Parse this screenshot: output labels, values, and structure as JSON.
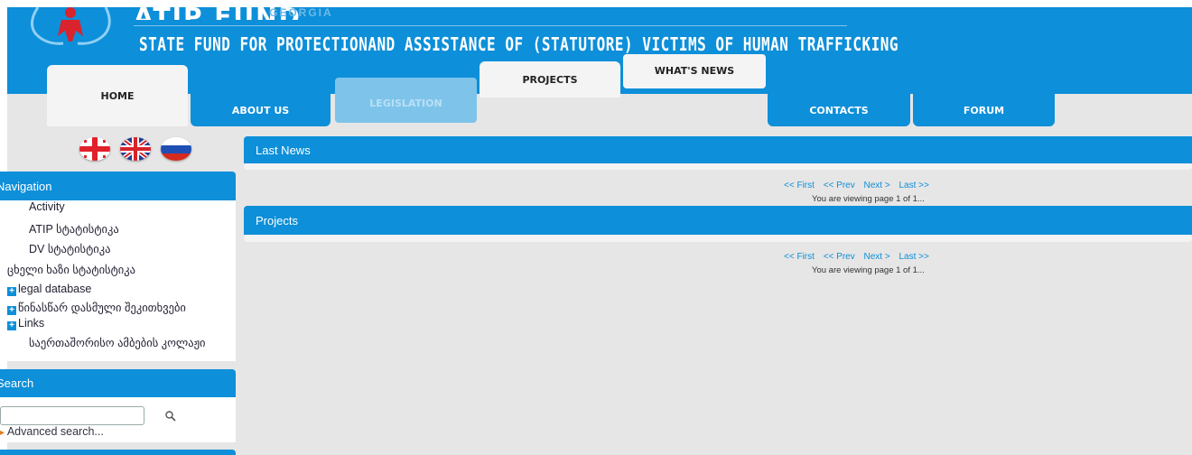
{
  "header": {
    "brand_title": "ATIP FUND",
    "brand_region": "GEORGIA",
    "subtitle": "STATE FUND FOR PROTECTIONAND ASSISTANCE OF (STATUTORE) VICTIMS OF HUMAN TRAFFICKING"
  },
  "tabs": {
    "home": "HOME",
    "about": "ABOUT US",
    "legislation": "LEGISLATION",
    "projects": "PROJECTS",
    "whats_new": "WHAT'S NEWS",
    "contacts": "CONTACTS",
    "forum": "FORUM"
  },
  "languages": [
    "georgian-flag-icon",
    "uk-flag-icon",
    "russian-flag-icon"
  ],
  "navigation": {
    "title": "Navigation",
    "items": [
      {
        "label": "Activity"
      },
      {
        "label": "ATIP სტატისტიკა"
      },
      {
        "label": "DV სტატისტიკა"
      },
      {
        "label": "ცხელი ხაზი სტატისტიკა"
      },
      {
        "label": "legal database"
      },
      {
        "label": "წინასწარ დასმული შეკითხვები"
      },
      {
        "label": "Links"
      },
      {
        "label": "საერთაშორისო ამბების კოლაჟი"
      }
    ]
  },
  "search": {
    "title": "Search",
    "advanced": "Advanced search..."
  },
  "sections": {
    "last_news": "Last News",
    "projects": "Projects"
  },
  "pager": {
    "first": "<< First",
    "prev": "<< Prev",
    "next": "Next >",
    "last": "Last >>",
    "viewing": "You are viewing page 1 of 1..."
  },
  "colors": {
    "accent": "#0d8fd9",
    "band": "#e6e6e6",
    "legislation_tab": "#7ec4ea"
  }
}
